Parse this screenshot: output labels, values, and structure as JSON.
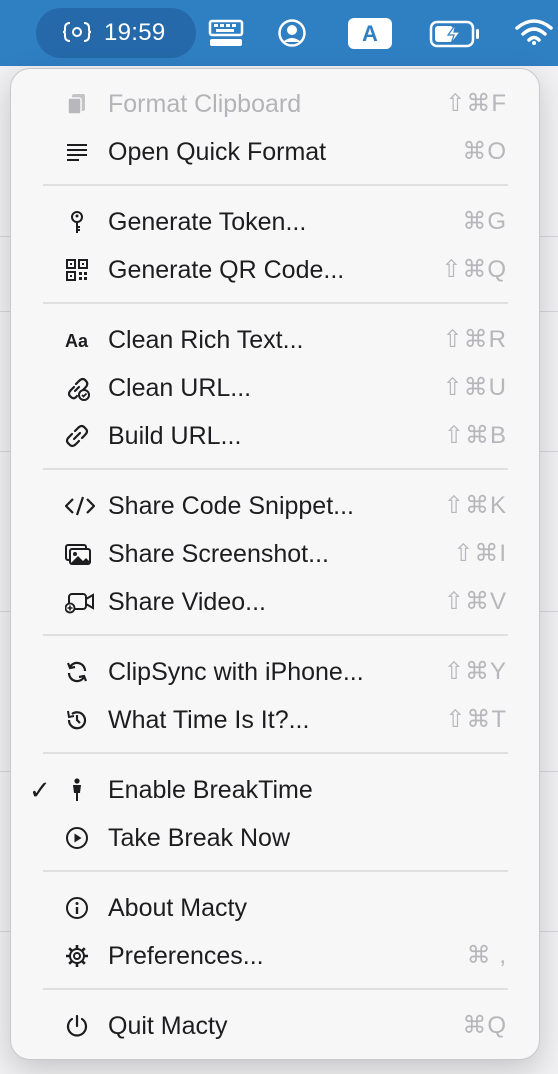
{
  "menubar": {
    "clock": "19:59",
    "icons": [
      "clipsync-icon",
      "keyboard-icon",
      "user-icon",
      "input-source-icon",
      "battery-icon",
      "wifi-icon"
    ],
    "input_source_letter": "A",
    "bar_color": "#2f7fc3"
  },
  "menu": {
    "items": [
      {
        "label": "Format Clipboard",
        "shortcut": "⇧⌘F",
        "icon": "clipboard-icon",
        "enabled": false
      },
      {
        "label": "Open Quick Format",
        "shortcut": "⌘O",
        "icon": "text-lines-icon",
        "enabled": true
      },
      {
        "label": "Generate Token...",
        "shortcut": "⌘G",
        "icon": "key-icon",
        "enabled": true
      },
      {
        "label": "Generate QR Code...",
        "shortcut": "⇧⌘Q",
        "icon": "qr-code-icon",
        "enabled": true
      },
      {
        "label": "Clean Rich Text...",
        "shortcut": "⇧⌘R",
        "icon": "text-format-icon",
        "enabled": true
      },
      {
        "label": "Clean URL...",
        "shortcut": "⇧⌘U",
        "icon": "link-clean-icon",
        "enabled": true
      },
      {
        "label": "Build URL...",
        "shortcut": "⇧⌘B",
        "icon": "link-icon",
        "enabled": true
      },
      {
        "label": "Share Code Snippet...",
        "shortcut": "⇧⌘K",
        "icon": "code-icon",
        "enabled": true
      },
      {
        "label": "Share Screenshot...",
        "shortcut": "⇧⌘I",
        "icon": "screenshot-icon",
        "enabled": true
      },
      {
        "label": "Share Video...",
        "shortcut": "⇧⌘V",
        "icon": "video-icon",
        "enabled": true
      },
      {
        "label": "ClipSync with iPhone...",
        "shortcut": "⇧⌘Y",
        "icon": "sync-icon",
        "enabled": true
      },
      {
        "label": "What Time Is It?...",
        "shortcut": "⇧⌘T",
        "icon": "time-history-icon",
        "enabled": true
      },
      {
        "label": "Enable BreakTime",
        "shortcut": "",
        "icon": "person-icon",
        "enabled": true,
        "checked": true,
        "check_mark": "✓"
      },
      {
        "label": "Take Break Now",
        "shortcut": "",
        "icon": "play-circle-icon",
        "enabled": true
      },
      {
        "label": "About Macty",
        "shortcut": "",
        "icon": "info-icon",
        "enabled": true
      },
      {
        "label": "Preferences...",
        "shortcut": "⌘ ,",
        "icon": "gear-icon",
        "enabled": true
      },
      {
        "label": "Quit Macty",
        "shortcut": "⌘Q",
        "icon": "power-icon",
        "enabled": true
      }
    ]
  }
}
